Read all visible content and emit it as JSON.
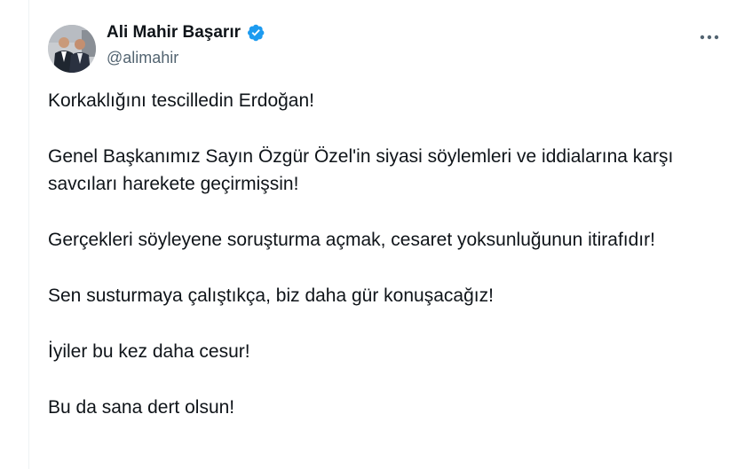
{
  "author": {
    "display_name": "Ali Mahir Başarır",
    "handle": "@alimahir",
    "verified": true
  },
  "icons": {
    "verified": "verified-badge-icon",
    "more": "more-horizontal-icon"
  },
  "colors": {
    "verified_blue": "#1d9bf0",
    "text_primary": "#0f1419",
    "text_secondary": "#536471"
  },
  "tweet": {
    "paragraphs": [
      "Korkaklığını tescilledin Erdoğan!",
      "Genel Başkanımız Sayın Özgür Özel'in siyasi söylemleri ve iddialarına karşı savcıları harekete geçirmişsin!",
      "Gerçekleri söyleyene soruşturma açmak, cesaret yoksunluğunun itirafıdır!",
      "Sen susturmaya çalıştıkça, biz daha gür konuşacağız!",
      "İyiler bu kez daha cesur!",
      "Bu da sana dert olsun!"
    ]
  }
}
